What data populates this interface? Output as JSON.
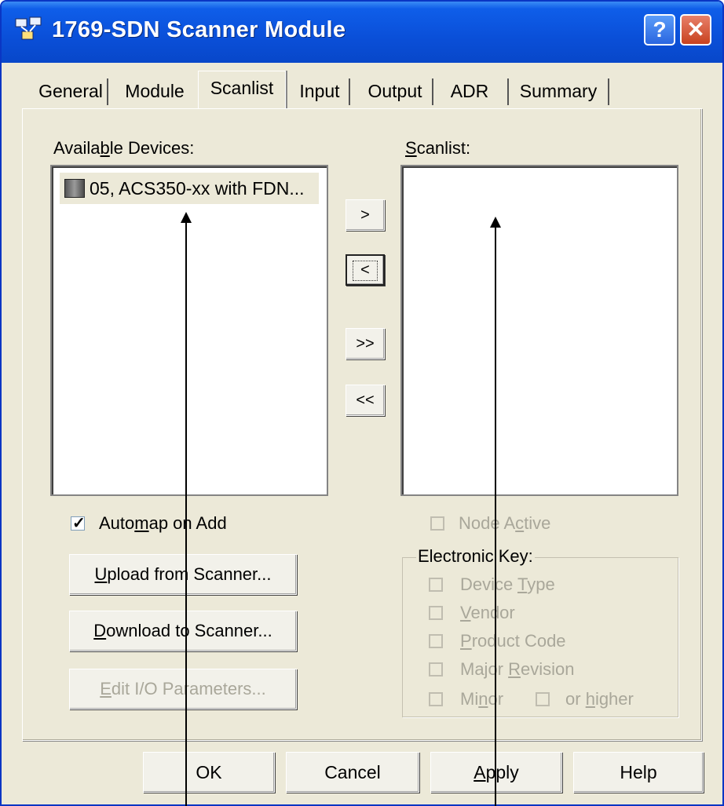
{
  "window": {
    "title": "1769-SDN Scanner Module"
  },
  "titlebar_buttons": {
    "help": "?",
    "close": "✕"
  },
  "tabs": [
    "General",
    "Module",
    "Scanlist",
    "Input",
    "Output",
    "ADR",
    "Summary"
  ],
  "active_tab": "Scanlist",
  "available": {
    "label_pre": "Availa",
    "label_u": "b",
    "label_post": "le Devices:",
    "items": [
      "05, ACS350-xx with FDN..."
    ]
  },
  "scanlist": {
    "label_u": "S",
    "label_post": "canlist:"
  },
  "move_buttons": {
    "add": ">",
    "remove": "<",
    "add_all": ">>",
    "remove_all": "<<"
  },
  "automap": {
    "label_pre": "Auto",
    "label_u": "m",
    "label_post": "ap on Add",
    "checked": true
  },
  "buttons": {
    "upload_u": "U",
    "upload_post": "pload from Scanner...",
    "download_u": "D",
    "download_post": "ownload to Scanner...",
    "edit_u": "E",
    "edit_post": "dit I/O Parameters..."
  },
  "node_active": {
    "label_pre": "Node A",
    "label_u": "c",
    "label_post": "tive",
    "enabled": false
  },
  "electronic_key": {
    "title": "Electronic Key:",
    "device_type": {
      "pre": "Device ",
      "u": "T",
      "post": "ype"
    },
    "vendor": {
      "u": "V",
      "post": "endor"
    },
    "product_code": {
      "u": "P",
      "post": "roduct Code"
    },
    "major_revision": {
      "pre": "Major ",
      "u": "R",
      "post": "evision"
    },
    "minor": {
      "pre": "Mi",
      "u": "n",
      "post": "or"
    },
    "or_higher": {
      "pre": "or ",
      "u": "h",
      "post": "igher"
    }
  },
  "footer": {
    "ok": "OK",
    "cancel": "Cancel",
    "apply_u": "A",
    "apply_post": "pply",
    "help": "Help"
  }
}
